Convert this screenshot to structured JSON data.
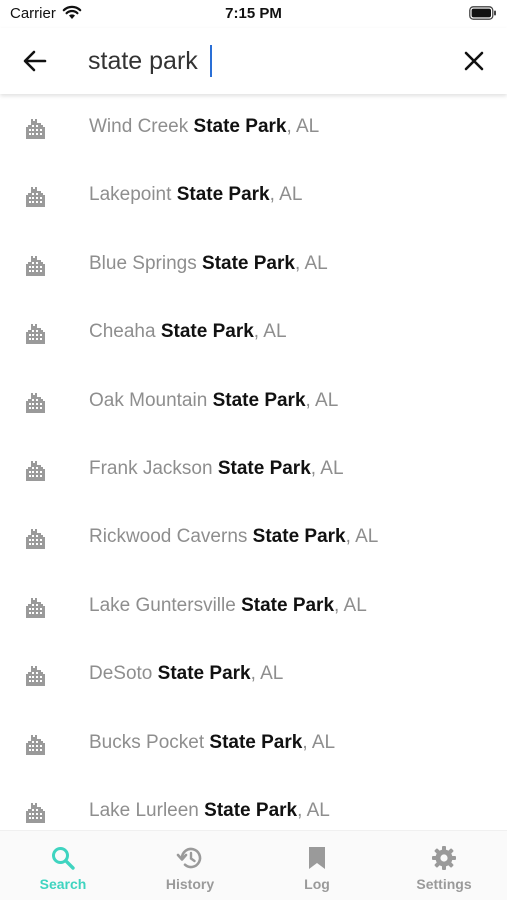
{
  "status": {
    "carrier": "Carrier",
    "time": "7:15 PM"
  },
  "search": {
    "value": "state park"
  },
  "results": [
    {
      "prefix": "Wind Creek ",
      "match": "State Park",
      "suffix": ", AL"
    },
    {
      "prefix": "Lakepoint ",
      "match": "State Park",
      "suffix": ", AL"
    },
    {
      "prefix": "Blue Springs ",
      "match": "State Park",
      "suffix": ", AL"
    },
    {
      "prefix": "Cheaha ",
      "match": "State Park",
      "suffix": ", AL"
    },
    {
      "prefix": "Oak Mountain ",
      "match": "State Park",
      "suffix": ", AL"
    },
    {
      "prefix": "Frank Jackson ",
      "match": "State Park",
      "suffix": ", AL"
    },
    {
      "prefix": "Rickwood Caverns ",
      "match": "State Park",
      "suffix": ", AL"
    },
    {
      "prefix": "Lake Guntersville ",
      "match": "State Park",
      "suffix": ", AL"
    },
    {
      "prefix": "DeSoto ",
      "match": "State Park",
      "suffix": ", AL"
    },
    {
      "prefix": "Bucks Pocket ",
      "match": "State Park",
      "suffix": ", AL"
    },
    {
      "prefix": "Lake Lurleen ",
      "match": "State Park",
      "suffix": ", AL"
    }
  ],
  "result_icon": "building-icon",
  "tabs": [
    {
      "label": "Search",
      "icon": "search-icon"
    },
    {
      "label": "History",
      "icon": "history-icon"
    },
    {
      "label": "Log",
      "icon": "bookmark-icon"
    },
    {
      "label": "Settings",
      "icon": "gear-icon"
    }
  ],
  "colors": {
    "accent": "#3fd4c0",
    "inactive": "#9a9a9a",
    "muted_text": "#8e8e8e",
    "caret": "#2a6fd6"
  }
}
